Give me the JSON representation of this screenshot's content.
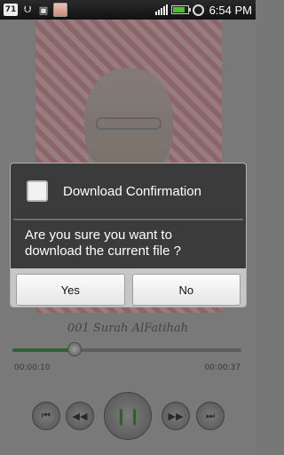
{
  "status_bar": {
    "badge": "71",
    "icons": [
      "usb-icon",
      "image-icon",
      "app-thumbnail-icon",
      "signal-icon",
      "battery-icon",
      "alarm-icon"
    ],
    "time": "6:54 PM",
    "battery_color": "#49c32c",
    "battery_level": 0.85
  },
  "player": {
    "track_title": "001 Surah AlFatihah",
    "time_elapsed": "00:00:10",
    "time_total": "00:00:37",
    "progress": 0.27,
    "accent_color": "#3b6d38",
    "controls": {
      "first": "previous-track-icon",
      "rewind": "rewind-icon",
      "play": "pause-icon",
      "forward": "fast-forward-icon",
      "last": "next-track-icon"
    }
  },
  "dialog": {
    "title": "Download Confirmation",
    "message": "Are you sure you want to download the current file ?",
    "yes_label": "Yes",
    "no_label": "No"
  }
}
